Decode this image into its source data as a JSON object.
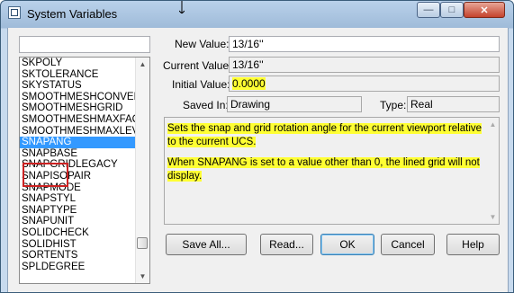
{
  "window": {
    "title": "System Variables",
    "controls": {
      "minimize": "—",
      "maximize": "□",
      "close": "✕"
    }
  },
  "filter": {
    "value": ""
  },
  "list": {
    "items": [
      "SKPOLY",
      "SKTOLERANCE",
      "SKYSTATUS",
      "SMOOTHMESHCONVERT",
      "SMOOTHMESHGRID",
      "SMOOTHMESHMAXFACE",
      "SMOOTHMESHMAXLEV",
      "SNAPANG",
      "SNAPBASE",
      "SNAPGRIDLEGACY",
      "SNAPISOPAIR",
      "SNAPMODE",
      "SNAPSTYL",
      "SNAPTYPE",
      "SNAPUNIT",
      "SOLIDCHECK",
      "SOLIDHIST",
      "SORTENTS",
      "SPLDEGREE"
    ],
    "selected": "SNAPANG"
  },
  "fields": {
    "new_value_label": "New Value:",
    "new_value": "13/16''",
    "current_value_label": "Current Value:",
    "current_value": "13/16''",
    "initial_value_label": "Initial Value:",
    "initial_value": "0.0000",
    "saved_in_label": "Saved In:",
    "saved_in": "Drawing",
    "type_label": "Type:",
    "type": "Real"
  },
  "description": {
    "p1": "Sets the snap and grid rotation angle for the current viewport relative to the current UCS.",
    "p2": "When SNAPANG is set to a value other than 0, the lined grid will not display."
  },
  "buttons": {
    "save_all": "Save All...",
    "read": "Read...",
    "ok": "OK",
    "cancel": "Cancel",
    "help": "Help"
  },
  "colors": {
    "highlight": "#ffff33",
    "selection": "#3399ff",
    "annotation_box": "#cc2222"
  }
}
